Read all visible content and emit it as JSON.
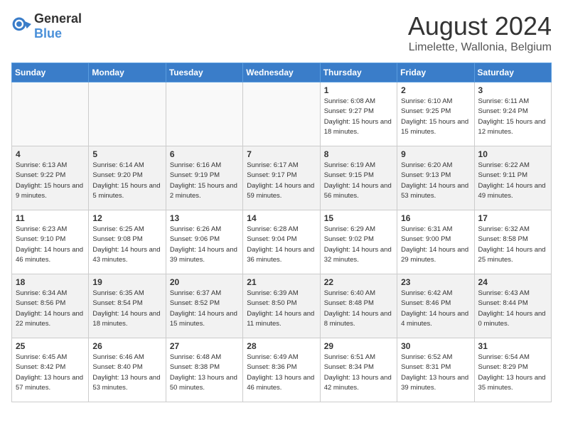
{
  "header": {
    "logo_general": "General",
    "logo_blue": "Blue",
    "month_title": "August 2024",
    "location": "Limelette, Wallonia, Belgium"
  },
  "days_of_week": [
    "Sunday",
    "Monday",
    "Tuesday",
    "Wednesday",
    "Thursday",
    "Friday",
    "Saturday"
  ],
  "weeks": [
    [
      {
        "day": "",
        "info": ""
      },
      {
        "day": "",
        "info": ""
      },
      {
        "day": "",
        "info": ""
      },
      {
        "day": "",
        "info": ""
      },
      {
        "day": "1",
        "sunrise": "6:08 AM",
        "sunset": "9:27 PM",
        "daylight": "15 hours and 18 minutes."
      },
      {
        "day": "2",
        "sunrise": "6:10 AM",
        "sunset": "9:25 PM",
        "daylight": "15 hours and 15 minutes."
      },
      {
        "day": "3",
        "sunrise": "6:11 AM",
        "sunset": "9:24 PM",
        "daylight": "15 hours and 12 minutes."
      }
    ],
    [
      {
        "day": "4",
        "sunrise": "6:13 AM",
        "sunset": "9:22 PM",
        "daylight": "15 hours and 9 minutes."
      },
      {
        "day": "5",
        "sunrise": "6:14 AM",
        "sunset": "9:20 PM",
        "daylight": "15 hours and 5 minutes."
      },
      {
        "day": "6",
        "sunrise": "6:16 AM",
        "sunset": "9:19 PM",
        "daylight": "15 hours and 2 minutes."
      },
      {
        "day": "7",
        "sunrise": "6:17 AM",
        "sunset": "9:17 PM",
        "daylight": "14 hours and 59 minutes."
      },
      {
        "day": "8",
        "sunrise": "6:19 AM",
        "sunset": "9:15 PM",
        "daylight": "14 hours and 56 minutes."
      },
      {
        "day": "9",
        "sunrise": "6:20 AM",
        "sunset": "9:13 PM",
        "daylight": "14 hours and 53 minutes."
      },
      {
        "day": "10",
        "sunrise": "6:22 AM",
        "sunset": "9:11 PM",
        "daylight": "14 hours and 49 minutes."
      }
    ],
    [
      {
        "day": "11",
        "sunrise": "6:23 AM",
        "sunset": "9:10 PM",
        "daylight": "14 hours and 46 minutes."
      },
      {
        "day": "12",
        "sunrise": "6:25 AM",
        "sunset": "9:08 PM",
        "daylight": "14 hours and 43 minutes."
      },
      {
        "day": "13",
        "sunrise": "6:26 AM",
        "sunset": "9:06 PM",
        "daylight": "14 hours and 39 minutes."
      },
      {
        "day": "14",
        "sunrise": "6:28 AM",
        "sunset": "9:04 PM",
        "daylight": "14 hours and 36 minutes."
      },
      {
        "day": "15",
        "sunrise": "6:29 AM",
        "sunset": "9:02 PM",
        "daylight": "14 hours and 32 minutes."
      },
      {
        "day": "16",
        "sunrise": "6:31 AM",
        "sunset": "9:00 PM",
        "daylight": "14 hours and 29 minutes."
      },
      {
        "day": "17",
        "sunrise": "6:32 AM",
        "sunset": "8:58 PM",
        "daylight": "14 hours and 25 minutes."
      }
    ],
    [
      {
        "day": "18",
        "sunrise": "6:34 AM",
        "sunset": "8:56 PM",
        "daylight": "14 hours and 22 minutes."
      },
      {
        "day": "19",
        "sunrise": "6:35 AM",
        "sunset": "8:54 PM",
        "daylight": "14 hours and 18 minutes."
      },
      {
        "day": "20",
        "sunrise": "6:37 AM",
        "sunset": "8:52 PM",
        "daylight": "14 hours and 15 minutes."
      },
      {
        "day": "21",
        "sunrise": "6:39 AM",
        "sunset": "8:50 PM",
        "daylight": "14 hours and 11 minutes."
      },
      {
        "day": "22",
        "sunrise": "6:40 AM",
        "sunset": "8:48 PM",
        "daylight": "14 hours and 8 minutes."
      },
      {
        "day": "23",
        "sunrise": "6:42 AM",
        "sunset": "8:46 PM",
        "daylight": "14 hours and 4 minutes."
      },
      {
        "day": "24",
        "sunrise": "6:43 AM",
        "sunset": "8:44 PM",
        "daylight": "14 hours and 0 minutes."
      }
    ],
    [
      {
        "day": "25",
        "sunrise": "6:45 AM",
        "sunset": "8:42 PM",
        "daylight": "13 hours and 57 minutes."
      },
      {
        "day": "26",
        "sunrise": "6:46 AM",
        "sunset": "8:40 PM",
        "daylight": "13 hours and 53 minutes."
      },
      {
        "day": "27",
        "sunrise": "6:48 AM",
        "sunset": "8:38 PM",
        "daylight": "13 hours and 50 minutes."
      },
      {
        "day": "28",
        "sunrise": "6:49 AM",
        "sunset": "8:36 PM",
        "daylight": "13 hours and 46 minutes."
      },
      {
        "day": "29",
        "sunrise": "6:51 AM",
        "sunset": "8:34 PM",
        "daylight": "13 hours and 42 minutes."
      },
      {
        "day": "30",
        "sunrise": "6:52 AM",
        "sunset": "8:31 PM",
        "daylight": "13 hours and 39 minutes."
      },
      {
        "day": "31",
        "sunrise": "6:54 AM",
        "sunset": "8:29 PM",
        "daylight": "13 hours and 35 minutes."
      }
    ]
  ],
  "labels": {
    "sunrise": "Sunrise:",
    "sunset": "Sunset:",
    "daylight": "Daylight:"
  }
}
